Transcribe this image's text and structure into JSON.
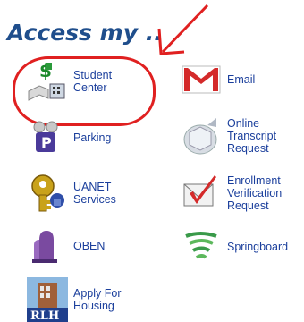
{
  "heading": "Access my ..",
  "links": {
    "student_center": "Student\nCenter",
    "email": "Email",
    "parking": "Parking",
    "online_transcript": "Online\nTranscript\nRequest",
    "uanet": "UANET\nServices",
    "enrollment_verification": "Enrollment\nVerification\nRequest",
    "oben": "OBEN",
    "springboard": "Springboard",
    "apply_housing": "Apply For\nHousing"
  },
  "icons": {
    "student_center": "student-center-icon",
    "email": "gmail-icon",
    "parking": "parking-icon",
    "online_transcript": "transcript-icon",
    "uanet": "key-icon",
    "enrollment_verification": "checkmark-envelope-icon",
    "oben": "oben-icon",
    "springboard": "springboard-icon",
    "apply_housing": "housing-icon",
    "housing_badge": "RLH"
  },
  "colors": {
    "heading": "#1f4e8c",
    "link": "#1b3f9c",
    "annotation": "#e02020"
  }
}
